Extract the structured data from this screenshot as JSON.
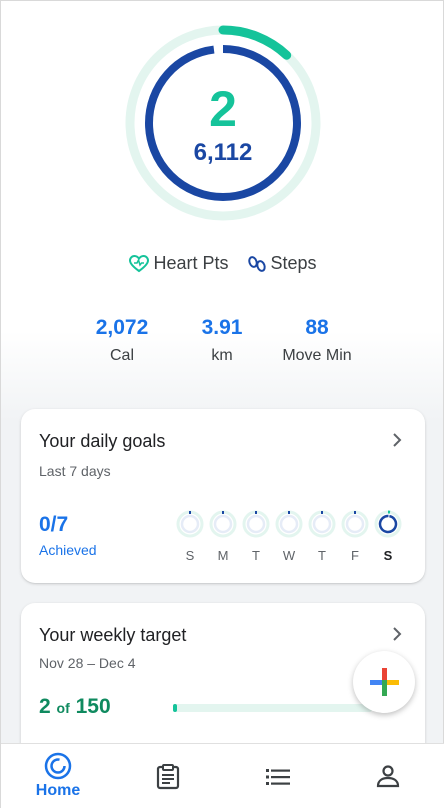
{
  "rings": {
    "heart_points": "2",
    "steps": "6,112",
    "heart_points_progress": 0.12,
    "steps_progress": 0.98,
    "colors": {
      "heart": "#15c39a",
      "heart_track": "#e3f5ef",
      "steps": "#1a47a3"
    }
  },
  "legend": {
    "heart_label": "Heart Pts",
    "steps_label": "Steps",
    "heart_icon": "heart-outline-icon",
    "steps_icon": "footsteps-icon"
  },
  "metrics": [
    {
      "value": "2,072",
      "label": "Cal"
    },
    {
      "value": "3.91",
      "label": "km"
    },
    {
      "value": "88",
      "label": "Move Min"
    }
  ],
  "daily_goals": {
    "title": "Your daily goals",
    "subtitle": "Last 7 days",
    "count": "0/7",
    "count_label": "Achieved",
    "days": [
      {
        "label": "S",
        "today": false
      },
      {
        "label": "M",
        "today": false
      },
      {
        "label": "T",
        "today": false
      },
      {
        "label": "W",
        "today": false
      },
      {
        "label": "T",
        "today": false
      },
      {
        "label": "F",
        "today": false
      },
      {
        "label": "S",
        "today": true
      }
    ]
  },
  "weekly_target": {
    "title": "Your weekly target",
    "date_range": "Nov 28 – Dec 4",
    "count": "2",
    "of_label": "of",
    "target": "150",
    "progress": 0.013
  },
  "fab": {
    "icon": "plus-icon"
  },
  "bottom_nav": {
    "items": [
      {
        "name": "home",
        "label": "Home",
        "icon": "home-ring-icon",
        "active": true
      },
      {
        "name": "journal",
        "icon": "clipboard-icon",
        "active": false
      },
      {
        "name": "browse",
        "icon": "list-icon",
        "active": false
      },
      {
        "name": "profile",
        "icon": "person-icon",
        "active": false
      }
    ]
  }
}
